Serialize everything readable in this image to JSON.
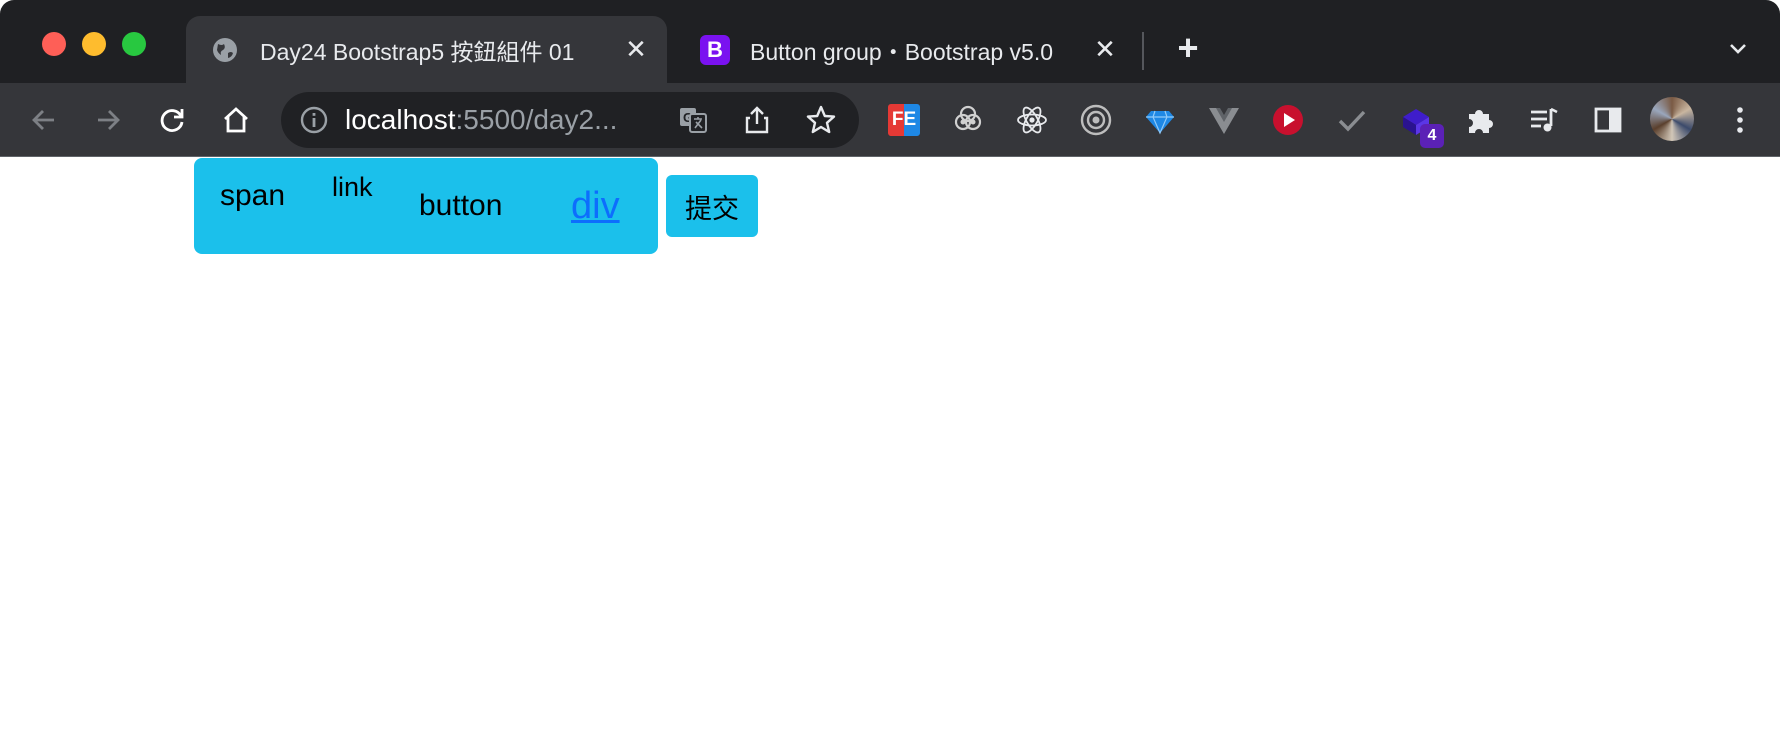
{
  "browser": {
    "tabs": [
      {
        "title": "Day24 Bootstrap5 按鈕組件 01",
        "favicon": "globe-icon",
        "active": true
      },
      {
        "title": "Button group・Bootstrap v5.0",
        "favicon": "bootstrap-icon",
        "favicon_letter": "B",
        "favicon_color": "#7a12f0",
        "active": false
      }
    ],
    "close_glyph": "✕",
    "new_tab_glyph": "+",
    "address": {
      "host": "localhost",
      "rest": ":5500/day2..."
    },
    "badge_count": "4",
    "extensions": [
      "fe-helper-icon",
      "eye-extension-icon",
      "react-devtools-icon",
      "target-icon",
      "gem-icon",
      "vue-devtools-icon",
      "play-icon",
      "check-icon",
      "cube-extension-icon",
      "puzzle-icon",
      "playlist-icon",
      "sidebar-icon"
    ],
    "extension_label_fe": "FE"
  },
  "page": {
    "group_items": {
      "span": "span",
      "link": "link",
      "button": "button",
      "div": "div"
    },
    "submit_label": "提交",
    "colors": {
      "info": "#1bc0eb",
      "link": "#0d6efd"
    }
  }
}
